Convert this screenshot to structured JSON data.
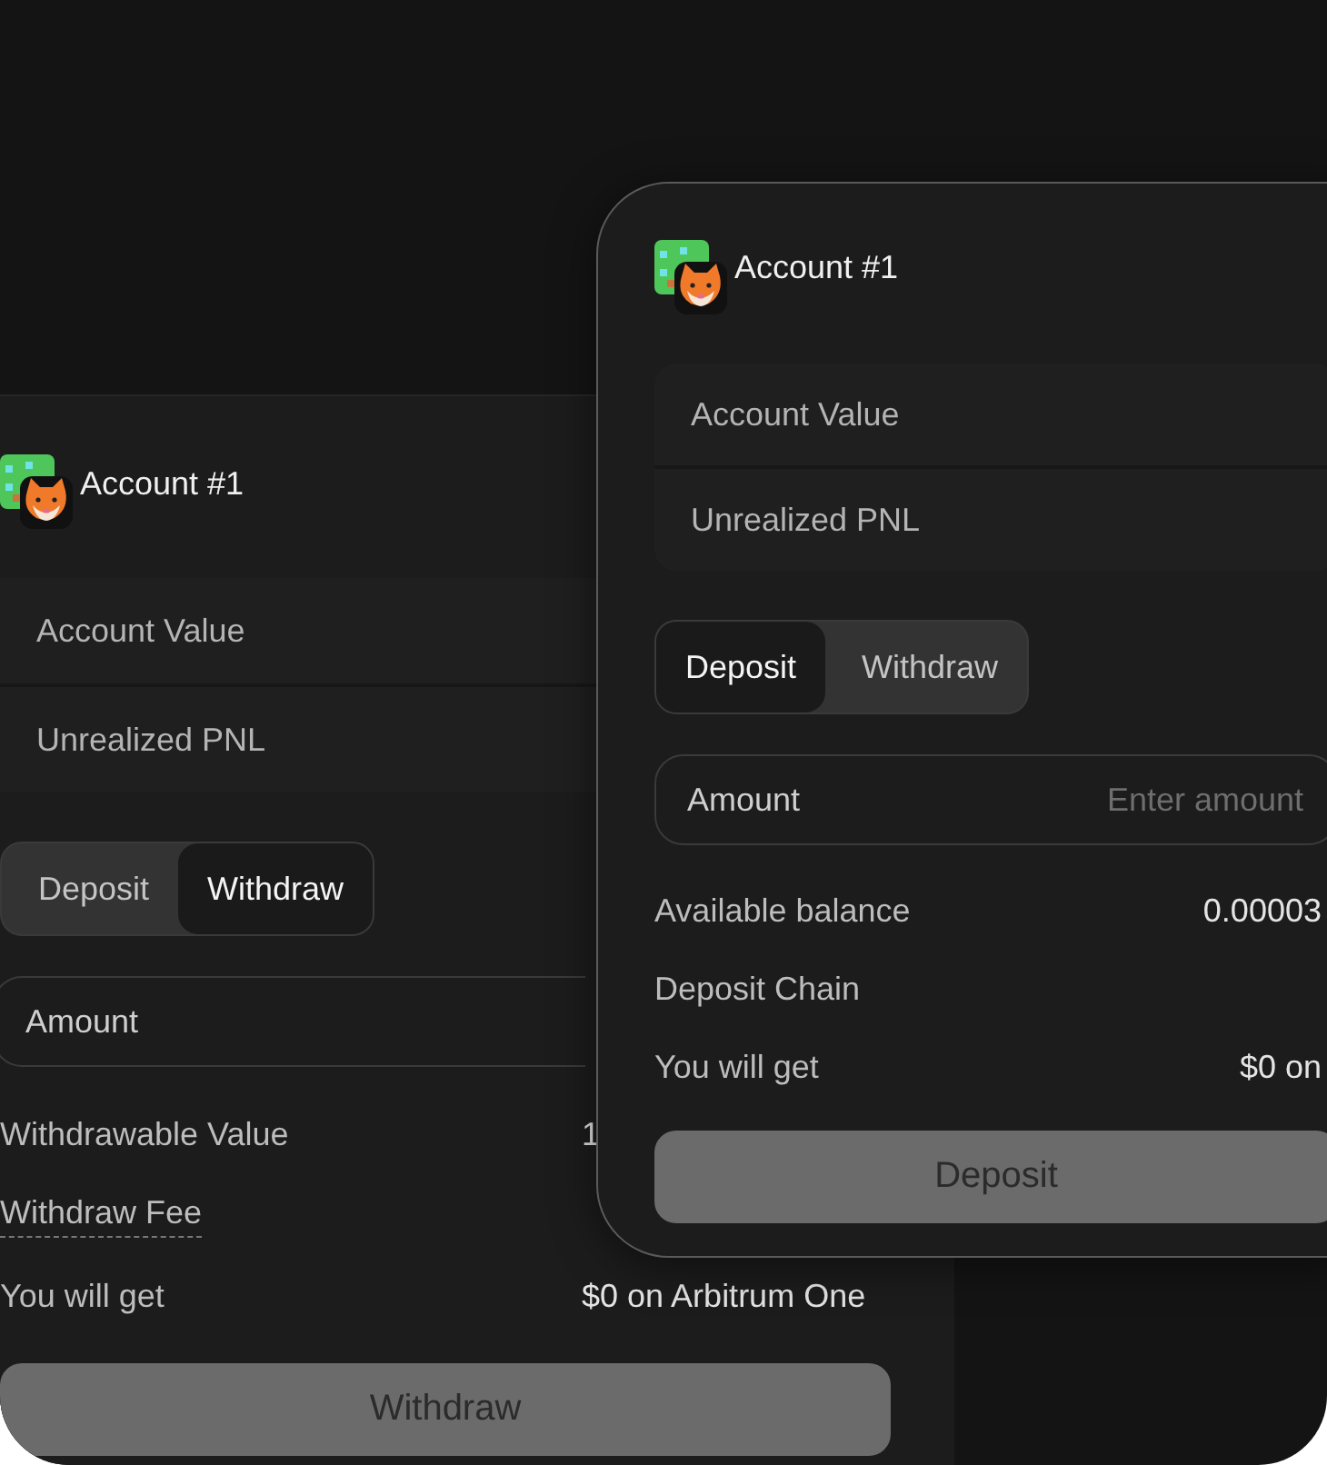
{
  "cards": [
    {
      "kind": "panel",
      "account": "Account #1",
      "stats": [
        "Account Value",
        "Unrealized PNL"
      ],
      "tabs": [
        {
          "label": "Deposit",
          "selected": false
        },
        {
          "label": "Withdraw",
          "selected": true
        }
      ],
      "amount": {
        "label": "Amount"
      },
      "details": [
        {
          "label": "Withdrawable Value",
          "value": "1",
          "kind": "plain"
        },
        {
          "label": "Withdraw Fee",
          "kind": "hint"
        },
        {
          "label": "You will get",
          "value": "$0 on Arbitrum One",
          "kind": "plain"
        }
      ],
      "action": "Withdraw"
    },
    {
      "kind": "popup",
      "account": "Account #1",
      "stats": [
        "Account Value",
        "Unrealized PNL"
      ],
      "tabs": [
        {
          "label": "Deposit",
          "selected": true
        },
        {
          "label": "Withdraw",
          "selected": false
        }
      ],
      "amount": {
        "label": "Amount",
        "placeholder": "Enter amount"
      },
      "details": [
        {
          "label": "Available balance",
          "value": "0.00003",
          "kind": "plain"
        },
        {
          "label": "Deposit Chain",
          "kind": "plain"
        },
        {
          "label": "You will get",
          "value": "$0  on",
          "kind": "plain"
        }
      ],
      "action": "Deposit"
    }
  ]
}
